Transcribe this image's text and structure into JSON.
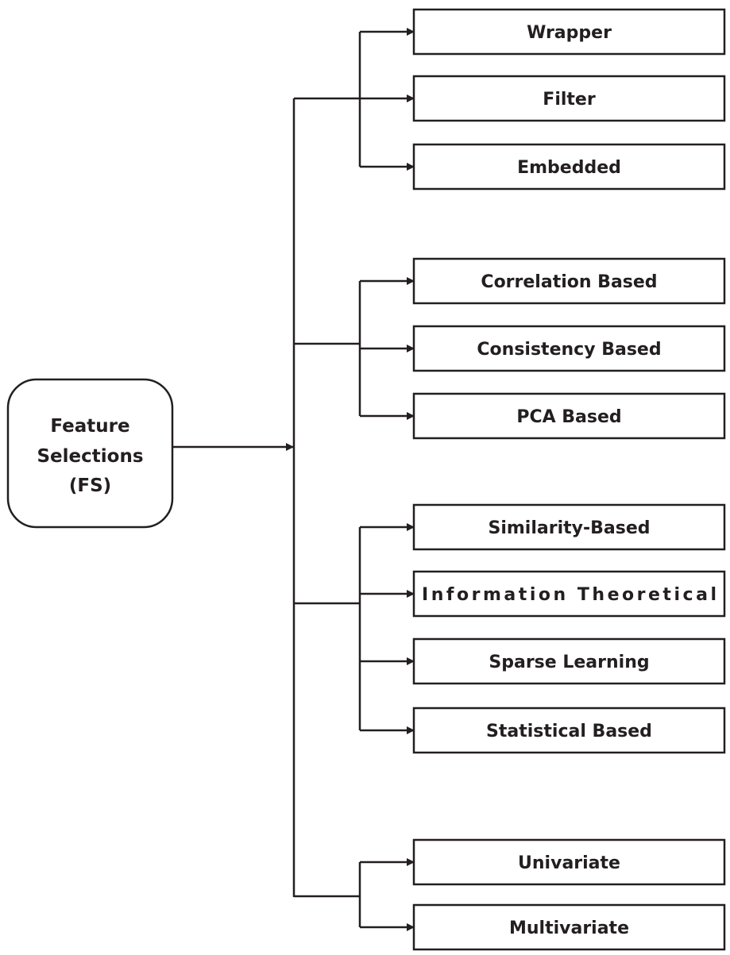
{
  "root": {
    "lines": [
      "Feature",
      "Selections",
      "(FS)"
    ]
  },
  "groups": [
    {
      "items": [
        "Wrapper",
        "Filter",
        "Embedded"
      ]
    },
    {
      "items": [
        "Correlation Based",
        "Consistency Based",
        "PCA Based"
      ]
    },
    {
      "items": [
        "Similarity-Based",
        "Information Theoretical",
        "Sparse Learning",
        "Statistical Based"
      ]
    },
    {
      "items": [
        "Univariate",
        "Multivariate"
      ]
    }
  ],
  "colors": {
    "stroke": "#231f20",
    "text": "#231f20",
    "background": "#ffffff"
  }
}
